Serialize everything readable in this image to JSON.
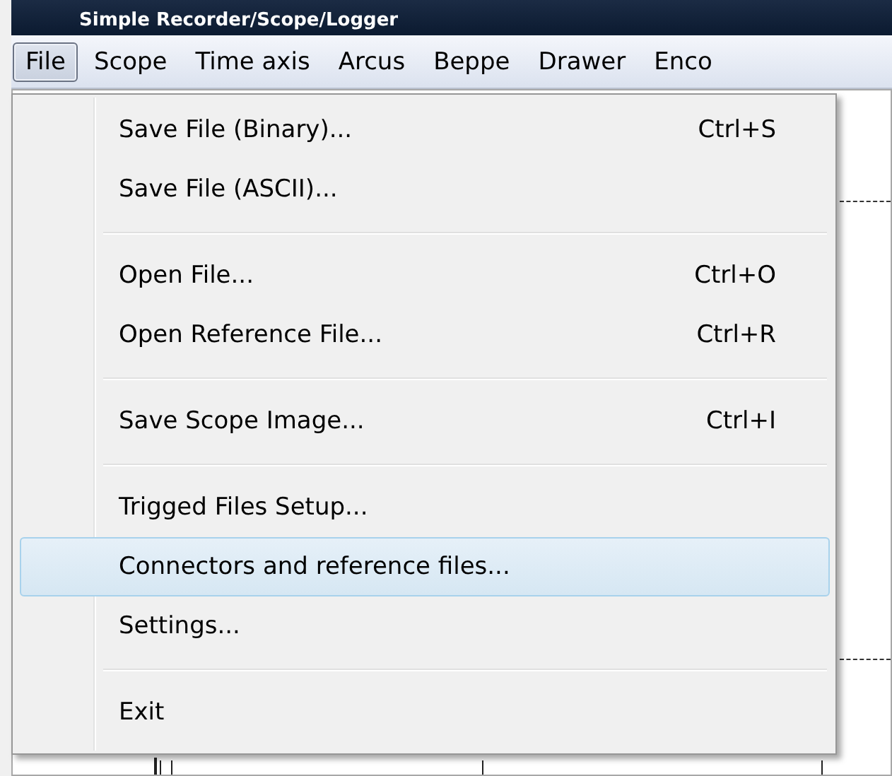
{
  "window": {
    "title": "Simple Recorder/Scope/Logger"
  },
  "menu_bar": [
    {
      "label": "File",
      "selected": true
    },
    {
      "label": "Scope",
      "selected": false
    },
    {
      "label": "Time axis",
      "selected": false
    },
    {
      "label": "Arcus",
      "selected": false
    },
    {
      "label": "Beppe",
      "selected": false
    },
    {
      "label": "Drawer",
      "selected": false
    },
    {
      "label": "Enco",
      "selected": false
    }
  ],
  "file_menu": [
    {
      "kind": "item",
      "label": "Save File (Binary)...",
      "shortcut": "Ctrl+S",
      "selected": false
    },
    {
      "kind": "item",
      "label": "Save File (ASCII)...",
      "selected": false
    },
    {
      "kind": "separator"
    },
    {
      "kind": "item",
      "label": "Open File...",
      "shortcut": "Ctrl+O",
      "selected": false
    },
    {
      "kind": "item",
      "label": "Open Reference File...",
      "shortcut": "Ctrl+R",
      "selected": false
    },
    {
      "kind": "separator"
    },
    {
      "kind": "item",
      "label": "Save Scope Image...",
      "shortcut": "Ctrl+I",
      "selected": false
    },
    {
      "kind": "separator"
    },
    {
      "kind": "item",
      "label": "Trigged Files Setup...",
      "selected": false
    },
    {
      "kind": "item",
      "label": "Connectors and reference files...",
      "selected": true
    },
    {
      "kind": "item",
      "label": "Settings...",
      "selected": false
    },
    {
      "kind": "separator"
    },
    {
      "kind": "item",
      "label": "Exit",
      "selected": false
    }
  ]
}
